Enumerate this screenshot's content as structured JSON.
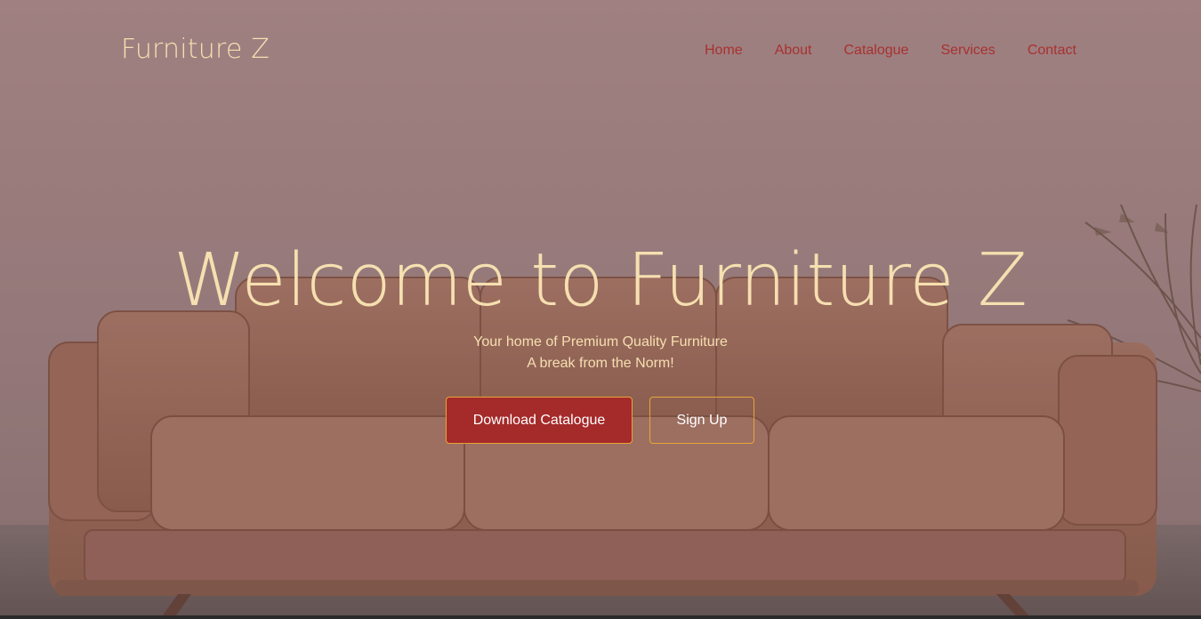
{
  "brand": {
    "name": "Furniture Z"
  },
  "nav": {
    "items": [
      {
        "label": "Home"
      },
      {
        "label": "About"
      },
      {
        "label": "Catalogue"
      },
      {
        "label": "Services"
      },
      {
        "label": "Contact"
      }
    ]
  },
  "hero": {
    "headline": "Welcome to Furniture Z",
    "subtitle_line1": "Your home of Premium Quality Furniture",
    "subtitle_line2": "A break from the Norm!",
    "primary_button": "Download Catalogue",
    "secondary_button": "Sign Up"
  },
  "colors": {
    "accent_cream": "#f6dfb0",
    "nav_red": "#a8312f",
    "button_red": "#a52a2a",
    "button_border": "#e8a43a"
  },
  "background": {
    "image_subject": "brown-leather-sofa-photo"
  }
}
